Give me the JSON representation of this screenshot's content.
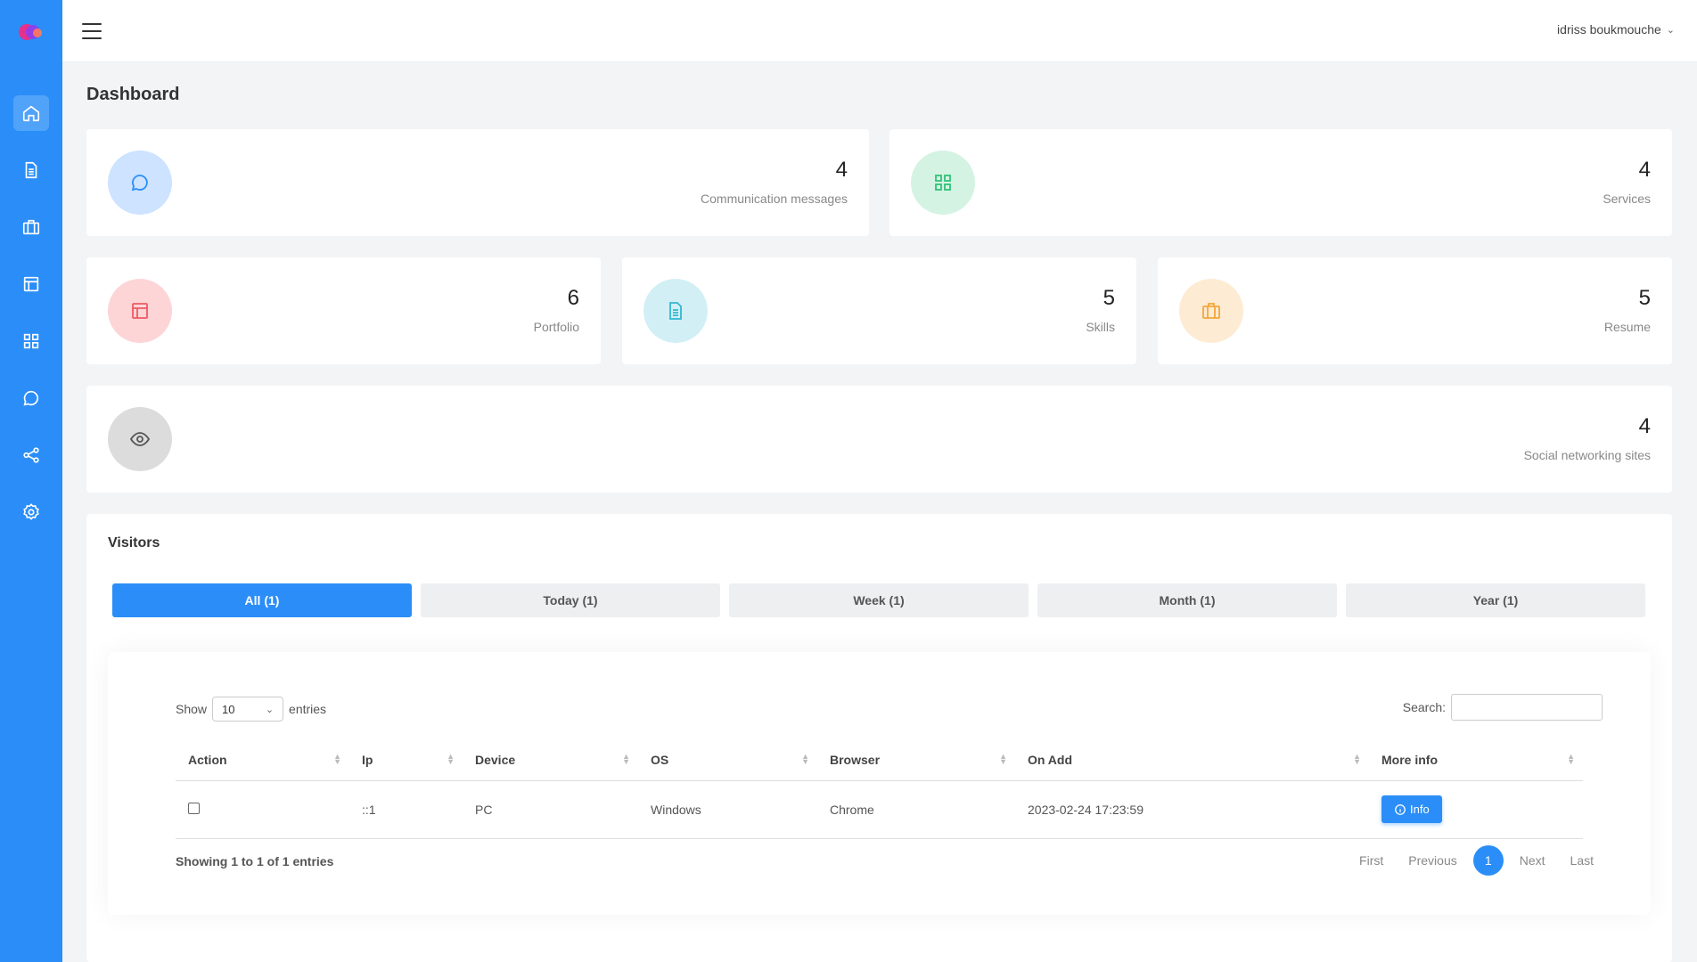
{
  "user": {
    "name": "idriss boukmouche"
  },
  "page": {
    "title": "Dashboard"
  },
  "stats": {
    "messages": {
      "value": "4",
      "label": "Communication messages"
    },
    "services": {
      "value": "4",
      "label": "Services"
    },
    "portfolio": {
      "value": "6",
      "label": "Portfolio"
    },
    "skills": {
      "value": "5",
      "label": "Skills"
    },
    "resume": {
      "value": "5",
      "label": "Resume"
    },
    "social": {
      "value": "4",
      "label": "Social networking sites"
    }
  },
  "visitors": {
    "title": "Visitors",
    "tabs": [
      "All (1)",
      "Today (1)",
      "Week (1)",
      "Month (1)",
      "Year (1)"
    ],
    "show_label": "Show",
    "entries_value": "10",
    "entries_label": "entries",
    "search_label": "Search:",
    "columns": [
      "Action",
      "Ip",
      "Device",
      "OS",
      "Browser",
      "On Add",
      "More info"
    ],
    "rows": [
      {
        "ip": "::1",
        "device": "PC",
        "os": "Windows",
        "browser": "Chrome",
        "on_add": "2023-02-24 17:23:59",
        "info": "Info"
      }
    ],
    "showing_text": "Showing 1 to 1 of 1 entries",
    "pager": {
      "first": "First",
      "previous": "Previous",
      "current": "1",
      "next": "Next",
      "last": "Last"
    }
  },
  "colors": {
    "primary": "#2b8ef8"
  }
}
